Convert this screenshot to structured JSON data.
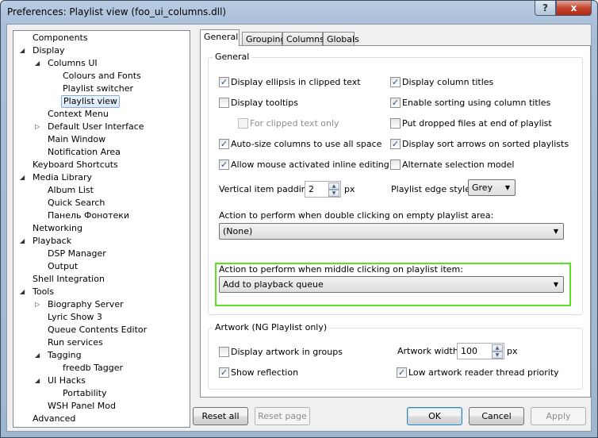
{
  "window": {
    "title": "Preferences: Playlist view (foo_ui_columns.dll)",
    "help_label": "?",
    "close_label": "x"
  },
  "tree": [
    {
      "label": "Components",
      "level": 0
    },
    {
      "label": "Display",
      "level": 0,
      "expander": "expanded"
    },
    {
      "label": "Columns UI",
      "level": 1,
      "expander": "expanded"
    },
    {
      "label": "Colours and Fonts",
      "level": 2
    },
    {
      "label": "Playlist switcher",
      "level": 2
    },
    {
      "label": "Playlist view",
      "level": 2,
      "selected": true
    },
    {
      "label": "Context Menu",
      "level": 1
    },
    {
      "label": "Default User Interface",
      "level": 1,
      "expander": "collapsed"
    },
    {
      "label": "Main Window",
      "level": 1
    },
    {
      "label": "Notification Area",
      "level": 1
    },
    {
      "label": "Keyboard Shortcuts",
      "level": 0
    },
    {
      "label": "Media Library",
      "level": 0,
      "expander": "expanded"
    },
    {
      "label": "Album List",
      "level": 1
    },
    {
      "label": "Quick Search",
      "level": 1
    },
    {
      "label": "Панель Фонотеки",
      "level": 1
    },
    {
      "label": "Networking",
      "level": 0
    },
    {
      "label": "Playback",
      "level": 0,
      "expander": "expanded"
    },
    {
      "label": "DSP Manager",
      "level": 1
    },
    {
      "label": "Output",
      "level": 1
    },
    {
      "label": "Shell Integration",
      "level": 0
    },
    {
      "label": "Tools",
      "level": 0,
      "expander": "expanded"
    },
    {
      "label": "Biography Server",
      "level": 1,
      "expander": "collapsed"
    },
    {
      "label": "Lyric Show 3",
      "level": 1
    },
    {
      "label": "Queue Contents Editor",
      "level": 1
    },
    {
      "label": "Run services",
      "level": 1
    },
    {
      "label": "Tagging",
      "level": 1,
      "expander": "expanded"
    },
    {
      "label": "freedb Tagger",
      "level": 2
    },
    {
      "label": "UI Hacks",
      "level": 1,
      "expander": "expanded"
    },
    {
      "label": "Portability",
      "level": 2
    },
    {
      "label": "WSH Panel Mod",
      "level": 1
    },
    {
      "label": "Advanced",
      "level": 0
    }
  ],
  "tabs": [
    {
      "label": "General",
      "active": true
    },
    {
      "label": "Grouping"
    },
    {
      "label": "Columns"
    },
    {
      "label": "Globals"
    }
  ],
  "general": {
    "group_label": "General",
    "checkboxes": [
      {
        "label": "Display ellipsis in clipped text",
        "checked": true,
        "col": 0,
        "row": 0
      },
      {
        "label": "Display tooltips",
        "checked": false,
        "col": 0,
        "row": 1
      },
      {
        "label": "For clipped text only",
        "checked": false,
        "disabled": true,
        "col": 0,
        "row": 2,
        "indent": true
      },
      {
        "label": "Auto-size columns to use all space",
        "checked": true,
        "col": 0,
        "row": 3
      },
      {
        "label": "Allow mouse activated inline editing",
        "checked": true,
        "col": 0,
        "row": 4
      },
      {
        "label": "Display column titles",
        "checked": true,
        "col": 1,
        "row": 0
      },
      {
        "label": "Enable sorting using column titles",
        "checked": true,
        "col": 1,
        "row": 1
      },
      {
        "label": "Put dropped files at end of playlist",
        "checked": false,
        "col": 1,
        "row": 2
      },
      {
        "label": "Display sort arrows on sorted playlists",
        "checked": true,
        "col": 1,
        "row": 3
      },
      {
        "label": "Alternate selection model",
        "checked": false,
        "col": 1,
        "row": 4
      }
    ],
    "padding_label": "Vertical item padding:",
    "padding_value": "2",
    "padding_unit": "px",
    "edge_label": "Playlist edge style:",
    "edge_value": "Grey",
    "double_click_label": "Action to perform when double clicking on empty playlist area:",
    "double_click_value": "(None)",
    "middle_click_label": "Action to perform when middle clicking on playlist item:",
    "middle_click_value": "Add to playback queue"
  },
  "artwork": {
    "group_label": "Artwork (NG Playlist only)",
    "display_in_groups": {
      "label": "Display artwork in groups",
      "checked": false
    },
    "show_reflection": {
      "label": "Show reflection",
      "checked": true
    },
    "width_label": "Artwork width:",
    "width_value": "100",
    "width_unit": "px",
    "low_priority": {
      "label": "Low artwork reader thread priority",
      "checked": true
    }
  },
  "buttons": {
    "reset_all": "Reset all",
    "reset_page": "Reset page",
    "ok": "OK",
    "cancel": "Cancel",
    "apply": "Apply"
  },
  "highlight_color": "#5de02a"
}
